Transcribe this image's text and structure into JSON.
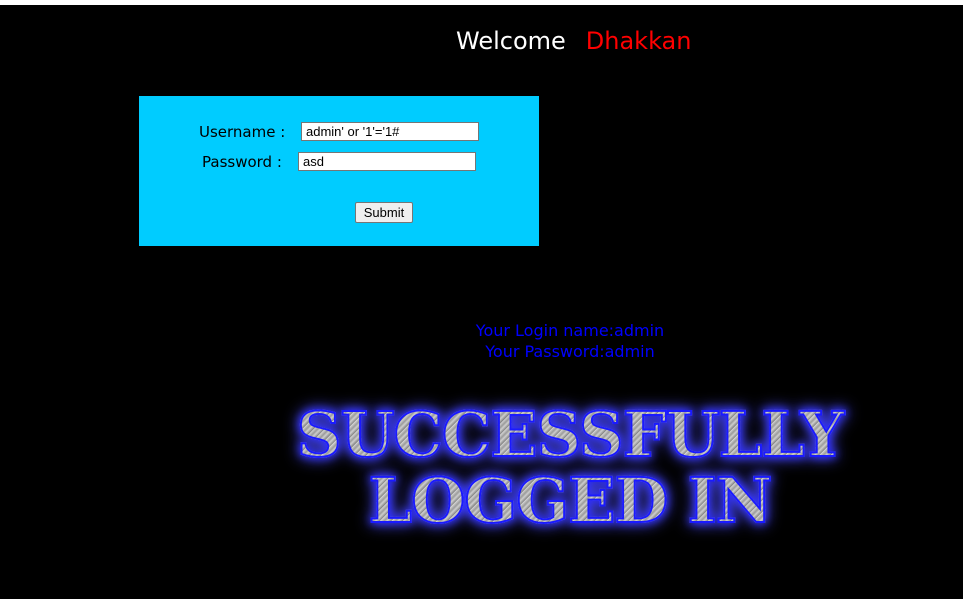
{
  "header": {
    "welcome": "Welcome",
    "name": "Dhakkan"
  },
  "form": {
    "username_label": "Username :",
    "username_value": "admin' or '1'='1#",
    "password_label": "Password :",
    "password_value": "asd",
    "submit_label": "Submit"
  },
  "result": {
    "login_name": "Your Login name:admin",
    "password": "Your Password:admin"
  },
  "banner": {
    "line1": "SUCCESSFULLY",
    "line2": "LOGGED IN"
  },
  "colors": {
    "background": "#000000",
    "form_background": "#00ccff",
    "welcome": "#ffffff",
    "name": "#ff0000",
    "result_text": "#0000ff",
    "banner_glow": "#2a2aff"
  }
}
